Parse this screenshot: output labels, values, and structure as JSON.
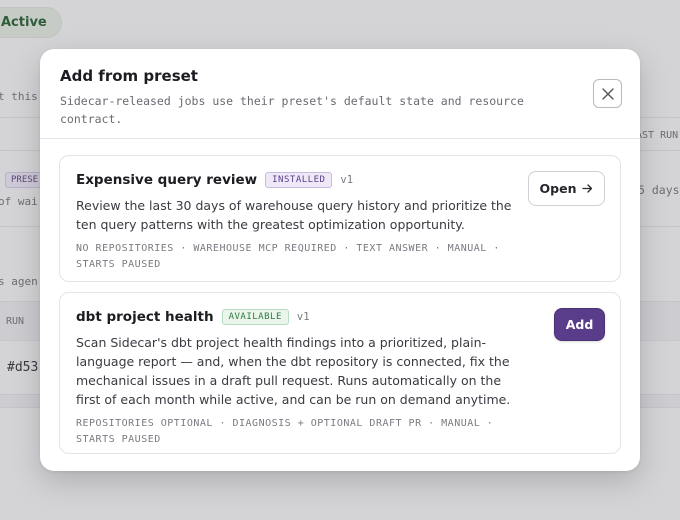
{
  "background": {
    "status_pill": "Active",
    "fragments": {
      "left_1": "t this",
      "left_2": "of wai",
      "left_3": "s agen",
      "left_4": "RUN",
      "left_5": "#d53",
      "right_1": "AST RUN",
      "right_2": "5 days",
      "badge": "PRESE"
    }
  },
  "modal": {
    "title": "Add from preset",
    "subtitle": "Sidecar-released jobs use their preset's default state and resource contract.",
    "close_icon": "close-icon"
  },
  "presets": [
    {
      "title": "Expensive query review",
      "badge": "INSTALLED",
      "version": "v1",
      "description": "Review the last 30 days of warehouse query history and prioritize the ten query patterns with the greatest optimization opportunity.",
      "meta": "NO REPOSITORIES · WAREHOUSE MCP REQUIRED · TEXT ANSWER · MANUAL · STARTS PAUSED",
      "action_label": "Open",
      "action_icon": "arrow-right-icon"
    },
    {
      "title": "dbt project health",
      "badge": "AVAILABLE",
      "version": "v1",
      "description": "Scan Sidecar's dbt project health findings into a prioritized, plain-language report — and, when the dbt repository is connected, fix the mechanical issues in a draft pull request. Runs automatically on the first of each month while active, and can be run on demand anytime.",
      "meta": "REPOSITORIES OPTIONAL · DIAGNOSIS + OPTIONAL DRAFT PR · MANUAL · STARTS PAUSED",
      "action_label": "Add"
    }
  ],
  "colors": {
    "accent": "#5a3d8a",
    "installed_badge": "#5a3d8a",
    "available_badge": "#2f7a43",
    "backdrop": "#d4d4d7"
  }
}
